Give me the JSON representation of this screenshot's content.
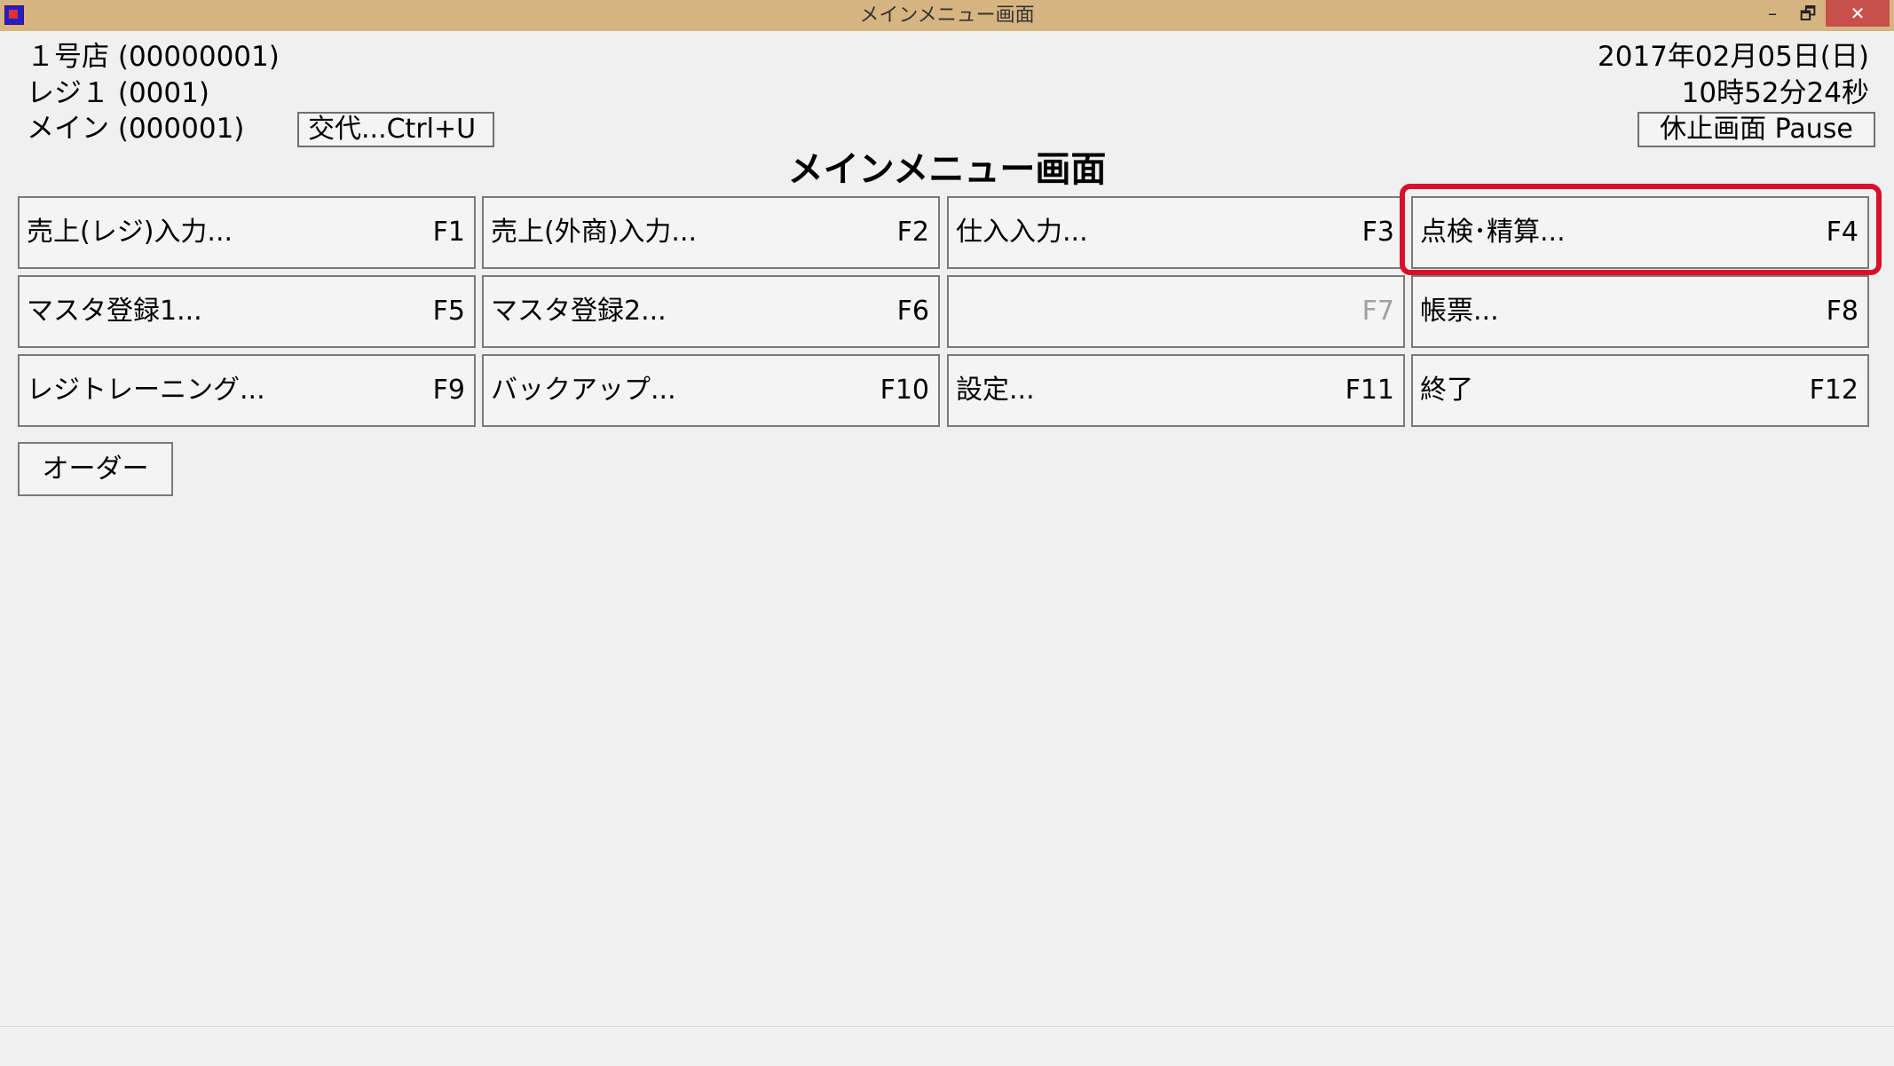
{
  "window": {
    "title": "メインメニュー画面",
    "minimize_glyph": "–",
    "maximize_glyph": "🗗",
    "close_glyph": "✕",
    "icon": "app-icon"
  },
  "header": {
    "store": "１号店 (00000001)",
    "register": "レジ１ (0001)",
    "main": "メイン (000001)",
    "shift_button": "交代...Ctrl+U",
    "date": "2017年02月05日(日)",
    "time": "10時52分24秒",
    "pause_button": "休止画面 Pause"
  },
  "page_title": "メインメニュー画面",
  "menu": [
    {
      "label": "売上(レジ)入力...",
      "key": "F1"
    },
    {
      "label": "売上(外商)入力...",
      "key": "F2"
    },
    {
      "label": "仕入入力...",
      "key": "F3"
    },
    {
      "label": "点検･精算...",
      "key": "F4"
    },
    {
      "label": "マスタ登録1...",
      "key": "F5"
    },
    {
      "label": "マスタ登録2...",
      "key": "F6"
    },
    {
      "label": "",
      "key": "F7"
    },
    {
      "label": "帳票...",
      "key": "F8"
    },
    {
      "label": "レジトレーニング...",
      "key": "F9"
    },
    {
      "label": "バックアップ...",
      "key": "F10"
    },
    {
      "label": "設定...",
      "key": "F11"
    },
    {
      "label": "終了",
      "key": "F12"
    }
  ],
  "order_button": "オーダー",
  "colors": {
    "titlebar": "#d7b583",
    "close_button": "#c7504a",
    "highlight": "#d8102a",
    "disabled_text": "#a0a0a0"
  }
}
